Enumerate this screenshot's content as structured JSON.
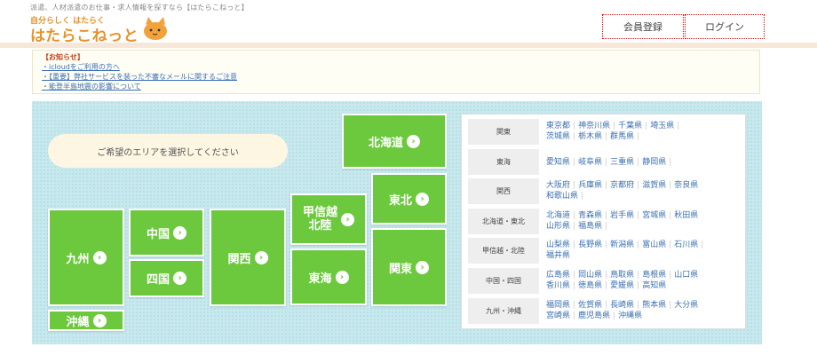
{
  "header": {
    "tagline": "派遣、人材派遣のお仕事・求人情報を探すなら【はたらこねっと】",
    "logo_small": "自分らしく はたらく",
    "logo_main": "はたらこねっと",
    "register_label": "会員登録",
    "login_label": "ログイン"
  },
  "notice": {
    "title": "【お知らせ】",
    "links": [
      "・icloudをご利用の方へ",
      "・【重要】弊社サービスを装った不審なメールに関するご注意",
      "・能登半島地震の影響について"
    ]
  },
  "map": {
    "prompt": "ご希望のエリアを選択してください",
    "arrow": "›",
    "regions": {
      "hokkaido": "北海道",
      "tohoku": "東北",
      "koshinetsu_l1": "甲信越",
      "koshinetsu_l2": "北陸",
      "kanto": "関東",
      "tokai": "東海",
      "kansai": "関西",
      "chugoku": "中国",
      "shikoku": "四国",
      "kyushu": "九州",
      "okinawa": "沖縄"
    }
  },
  "prefectures": [
    {
      "region": "関東",
      "items": [
        "東京都",
        "神奈川県",
        "千葉県",
        "埼玉県",
        "茨城県",
        "栃木県",
        "群馬県"
      ]
    },
    {
      "region": "東海",
      "items": [
        "愛知県",
        "岐阜県",
        "三重県",
        "静岡県"
      ]
    },
    {
      "region": "関西",
      "items": [
        "大阪府",
        "兵庫県",
        "京都府",
        "滋賀県",
        "奈良県",
        "和歌山県"
      ]
    },
    {
      "region": "北海道・東北",
      "items": [
        "北海道",
        "青森県",
        "岩手県",
        "宮城県",
        "秋田県",
        "山形県",
        "福島県"
      ]
    },
    {
      "region": "甲信越・北陸",
      "items": [
        "山梨県",
        "長野県",
        "新潟県",
        "富山県",
        "石川県",
        "福井県"
      ]
    },
    {
      "region": "中国・四国",
      "items": [
        "広島県",
        "岡山県",
        "鳥取県",
        "島根県",
        "山口県",
        "香川県",
        "徳島県",
        "愛媛県",
        "高知県"
      ]
    },
    {
      "region": "九州・沖縄",
      "items": [
        "福岡県",
        "佐賀県",
        "長崎県",
        "熊本県",
        "大分県",
        "宮崎県",
        "鹿児島県",
        "沖縄県"
      ]
    }
  ]
}
